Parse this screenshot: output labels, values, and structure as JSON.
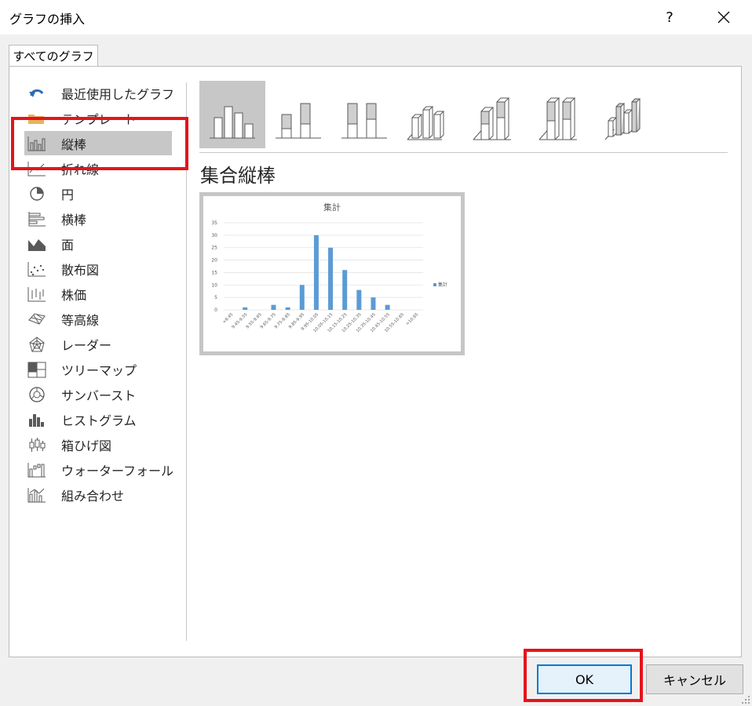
{
  "dialog": {
    "title": "グラフの挿入",
    "help_label": "?",
    "tab_label": "すべてのグラフ",
    "ok_label": "OK",
    "cancel_label": "キャンセル"
  },
  "chart_types": [
    {
      "label": "最近使用したグラフ",
      "icon": "recent-icon"
    },
    {
      "label": "テンプレート",
      "icon": "folder-icon"
    },
    {
      "label": "縦棒",
      "icon": "column-chart-icon"
    },
    {
      "label": "折れ線",
      "icon": "line-chart-icon"
    },
    {
      "label": "円",
      "icon": "pie-chart-icon"
    },
    {
      "label": "横棒",
      "icon": "bar-chart-icon"
    },
    {
      "label": "面",
      "icon": "area-chart-icon"
    },
    {
      "label": "散布図",
      "icon": "scatter-chart-icon"
    },
    {
      "label": "株価",
      "icon": "stock-chart-icon"
    },
    {
      "label": "等高線",
      "icon": "surface-chart-icon"
    },
    {
      "label": "レーダー",
      "icon": "radar-chart-icon"
    },
    {
      "label": "ツリーマップ",
      "icon": "treemap-icon"
    },
    {
      "label": "サンバースト",
      "icon": "sunburst-icon"
    },
    {
      "label": "ヒストグラム",
      "icon": "histogram-icon"
    },
    {
      "label": "箱ひげ図",
      "icon": "box-whisker-icon"
    },
    {
      "label": "ウォーターフォール",
      "icon": "waterfall-icon"
    },
    {
      "label": "組み合わせ",
      "icon": "combo-chart-icon"
    }
  ],
  "selected_type": "縦棒",
  "subtype_heading": "集合縦棒",
  "subtypes": [
    "clustered-column-icon",
    "stacked-column-icon",
    "100-stacked-column-icon",
    "3d-clustered-column-icon",
    "3d-stacked-column-icon",
    "3d-100-stacked-column-icon",
    "3d-column-icon"
  ],
  "colors": {
    "highlight": "#e5141b",
    "series": "#5b9bd5",
    "selected": "#c7c7c7"
  },
  "chart_data": {
    "type": "bar",
    "title": "集計",
    "categories": [
      "<9.45",
      "9.45-9.55",
      "9.55-9.65",
      "9.65-9.75",
      "9.75-9.85",
      "9.85-9.95",
      "9.95-10.05",
      "10.05-10.15",
      "10.15-10.25",
      "10.25-10.35",
      "10.35-10.45",
      "10.45-10.55",
      "10.55-10.65",
      ">10.65"
    ],
    "series": [
      {
        "name": "集計",
        "values": [
          0,
          1,
          0,
          2,
          1,
          10,
          30,
          25,
          16,
          8,
          5,
          2,
          0,
          0
        ]
      }
    ],
    "yticks": [
      0,
      5,
      10,
      15,
      20,
      25,
      30,
      35
    ],
    "ylim": [
      0,
      35
    ],
    "legend": "right"
  }
}
